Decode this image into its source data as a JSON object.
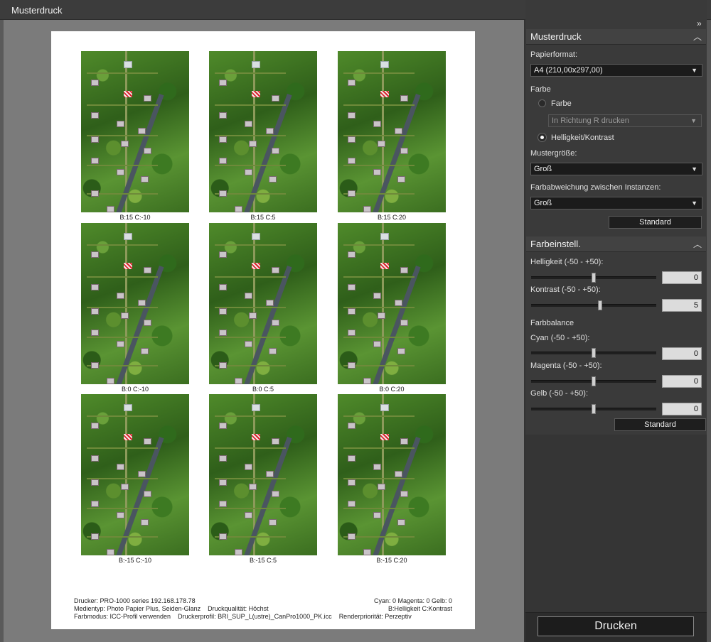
{
  "window": {
    "title": "Musterdruck"
  },
  "preview": {
    "thumbnails": [
      {
        "caption": "B:15 C:-10"
      },
      {
        "caption": "B:15 C:5"
      },
      {
        "caption": "B:15 C:20"
      },
      {
        "caption": "B:0 C:-10"
      },
      {
        "caption": "B:0 C:5"
      },
      {
        "caption": "B:0 C:20"
      },
      {
        "caption": "B:-15 C:-10"
      },
      {
        "caption": "B:-15 C:5"
      },
      {
        "caption": "B:-15 C:20"
      }
    ],
    "info": {
      "printer": "Drucker: PRO-1000 series 192.168.178.78",
      "media": "Medientyp: Photo Papier Plus, Seiden-Glanz",
      "quality": "Druckqualität: Höchst",
      "colormode": "Farbmodus: ICC-Profil verwenden",
      "profile": "Druckerprofil: BRI_SUP_L(ustre)_CanPro1000_PK.icc",
      "intent": "Renderpriorität: Perzeptiv",
      "cmy": "Cyan: 0  Magenta: 0  Gelb: 0",
      "legend": "B:Helligkeit C:Kontrast"
    }
  },
  "panel": {
    "musterdruck": {
      "header": "Musterdruck",
      "paper_label": "Papierformat:",
      "paper_value": "A4 (210,00x297,00)",
      "color_label": "Farbe",
      "radio_color": "Farbe",
      "direction_value": "In Richtung R drucken",
      "radio_brightness": "Helligkeit/Kontrast",
      "size_label": "Mustergröße:",
      "size_value": "Groß",
      "deviation_label": "Farbabweichung zwischen Instanzen:",
      "deviation_value": "Groß",
      "standard_button": "Standard"
    },
    "farbeinstell": {
      "header": "Farbeinstell.",
      "brightness_label": "Helligkeit (-50 - +50):",
      "brightness_value": "0",
      "contrast_label": "Kontrast (-50 - +50):",
      "contrast_value": "5",
      "balance_label": "Farbbalance",
      "cyan_label": "Cyan (-50 - +50):",
      "cyan_value": "0",
      "magenta_label": "Magenta (-50 - +50):",
      "magenta_value": "0",
      "yellow_label": "Gelb (-50 - +50):",
      "yellow_value": "0",
      "standard_button": "Standard"
    },
    "print_button": "Drucken"
  }
}
